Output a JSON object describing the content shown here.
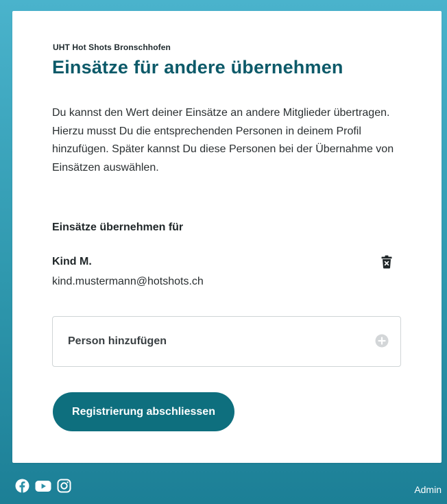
{
  "header": {
    "club_name": "UHT Hot Shots Bronschhofen",
    "title": "Einsätze für andere übernehmen"
  },
  "description": "Du kannst den Wert deiner Einsätze an andere Mitglieder übertragen. Hierzu musst Du die entsprechenden Personen in deinem Profil hinzufügen. Später kannst Du diese Personen bei der Übernahme von Einsätzen auswählen.",
  "section": {
    "label": "Einsätze übernehmen für"
  },
  "persons": [
    {
      "name": "Kind M.",
      "email": "kind.mustermann@hotshots.ch",
      "delete_icon": "trash-icon"
    }
  ],
  "add_person": {
    "label": "Person hinzufügen",
    "icon": "plus-circle-icon"
  },
  "submit_button": {
    "label": "Registrierung abschliessen"
  },
  "footer": {
    "social_icons": [
      "facebook-icon",
      "youtube-icon",
      "instagram-icon"
    ],
    "admin_label": "Admin"
  },
  "colors": {
    "accent": "#0e6f7e",
    "title": "#0d5a69",
    "background_top": "#4ab3cc",
    "background_bottom": "#1c7f96"
  }
}
